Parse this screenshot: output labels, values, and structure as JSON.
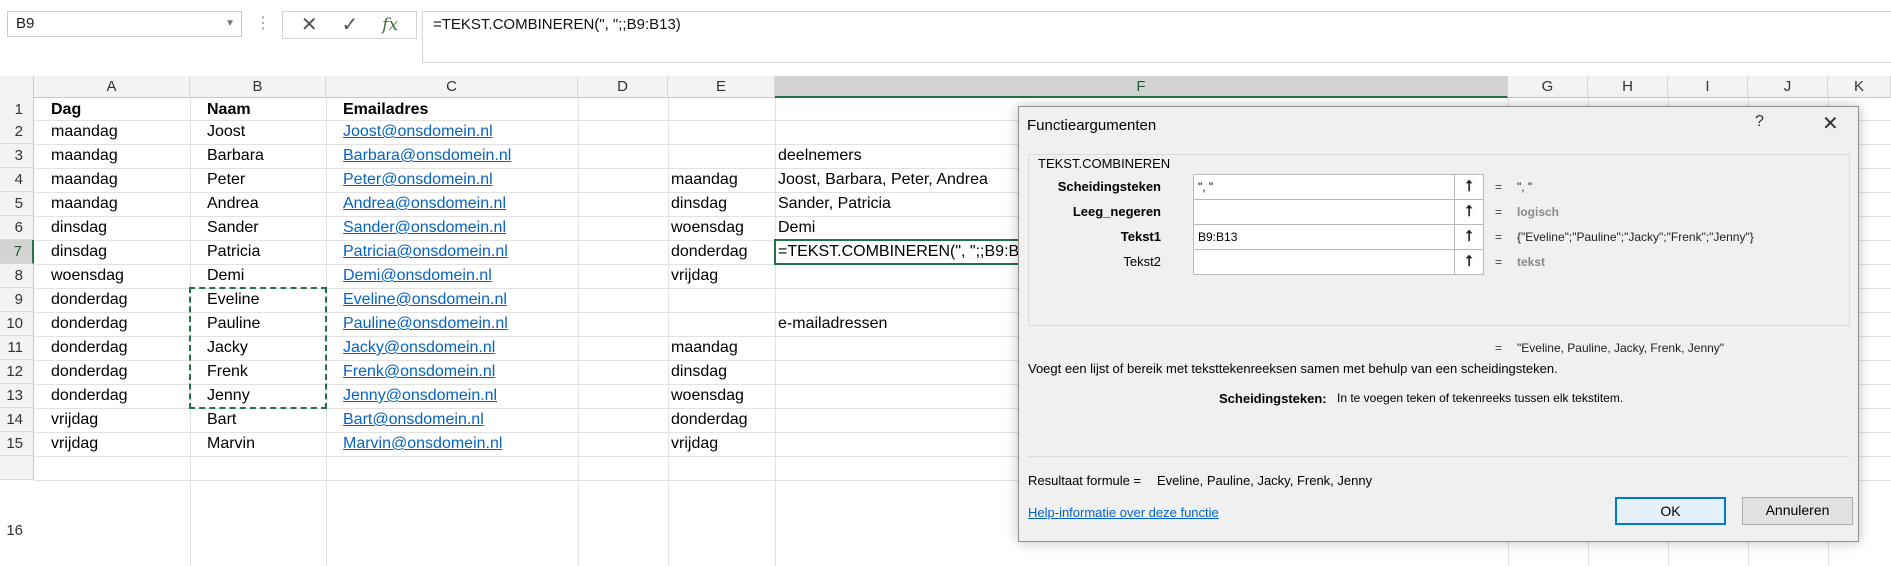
{
  "formula_bar": {
    "name_box": "B9",
    "formula": "=TEKST.COMBINEREN(\", \";;B9:B13)",
    "cancel_glyph": "✕",
    "enter_glyph": "✓",
    "fx_glyph": "fx",
    "dots": "⋮",
    "dropdown_glyph": "▼"
  },
  "sheet": {
    "columns": [
      "A",
      "B",
      "C",
      "D",
      "E",
      "F",
      "G",
      "H",
      "I",
      "J",
      "K"
    ],
    "active_column": "F",
    "active_row": 7,
    "rows": [
      {
        "row": 1,
        "A": "Dag",
        "B": "Naam",
        "C": "Emailadres",
        "E": "",
        "F": ""
      },
      {
        "row": 2,
        "A": "maandag",
        "B": "Joost",
        "C": "Joost@onsdomein.nl",
        "E": "",
        "F": ""
      },
      {
        "row": 3,
        "A": "maandag",
        "B": "Barbara",
        "C": "Barbara@onsdomein.nl",
        "E": "",
        "F": "deelnemers"
      },
      {
        "row": 4,
        "A": "maandag",
        "B": "Peter",
        "C": "Peter@onsdomein.nl",
        "E": "maandag",
        "F": "Joost, Barbara, Peter, Andrea"
      },
      {
        "row": 5,
        "A": "maandag",
        "B": "Andrea",
        "C": "Andrea@onsdomein.nl",
        "E": "dinsdag",
        "F": "Sander, Patricia"
      },
      {
        "row": 6,
        "A": "dinsdag",
        "B": "Sander",
        "C": "Sander@onsdomein.nl",
        "E": "woensdag",
        "F": "Demi"
      },
      {
        "row": 7,
        "A": "dinsdag",
        "B": "Patricia",
        "C": "Patricia@onsdomein.nl",
        "E": "donderdag",
        "F": "=TEKST.COMBINEREN(\", \";;B9:B1"
      },
      {
        "row": 8,
        "A": "woensdag",
        "B": "Demi",
        "C": "Demi@onsdomein.nl",
        "E": "vrijdag",
        "F": ""
      },
      {
        "row": 9,
        "A": "donderdag",
        "B": "Eveline",
        "C": "Eveline@onsdomein.nl",
        "E": "",
        "F": ""
      },
      {
        "row": 10,
        "A": "donderdag",
        "B": "Pauline",
        "C": "Pauline@onsdomein.nl",
        "E": "",
        "F": "e-mailadressen"
      },
      {
        "row": 11,
        "A": "donderdag",
        "B": "Jacky",
        "C": "Jacky@onsdomein.nl",
        "E": "maandag",
        "F": ""
      },
      {
        "row": 12,
        "A": "donderdag",
        "B": "Frenk",
        "C": "Frenk@onsdomein.nl",
        "E": "dinsdag",
        "F": ""
      },
      {
        "row": 13,
        "A": "donderdag",
        "B": "Jenny",
        "C": "Jenny@onsdomein.nl",
        "E": "woensdag",
        "F": ""
      },
      {
        "row": 14,
        "A": "vrijdag",
        "B": "Bart",
        "C": "Bart@onsdomein.nl",
        "E": "donderdag",
        "F": ""
      },
      {
        "row": 15,
        "A": "vrijdag",
        "B": "Marvin",
        "C": "Marvin@onsdomein.nl",
        "E": "vrijdag",
        "F": ""
      },
      {
        "row": 16,
        "A": "",
        "B": "",
        "C": "",
        "E": "",
        "F": ""
      }
    ]
  },
  "dialog": {
    "title": "Functieargumenten",
    "help_glyph": "?",
    "close_glyph": "✕",
    "function_name": "TEKST.COMBINEREN",
    "arguments": [
      {
        "label": "Scheidingsteken",
        "bold": true,
        "value": "\", \"",
        "button_glyph": "⭡",
        "equals": "=",
        "result": "\", \"",
        "result_gray": false
      },
      {
        "label": "Leeg_negeren",
        "bold": true,
        "value": "",
        "button_glyph": "⭡",
        "equals": "=",
        "result": "logisch",
        "result_gray": true
      },
      {
        "label": "Tekst1",
        "bold": true,
        "value": "B9:B13",
        "button_glyph": "⭡",
        "equals": "=",
        "result": "{\"Eveline\";\"Pauline\";\"Jacky\";\"Frenk\";\"Jenny\"}",
        "result_gray": false
      },
      {
        "label": "Tekst2",
        "bold": false,
        "value": "",
        "button_glyph": "⭡",
        "equals": "=",
        "result": "tekst",
        "result_gray": true
      }
    ],
    "result_equals": "=",
    "result_preview": "\"Eveline, Pauline, Jacky, Frenk, Jenny\"",
    "description": "Voegt een lijst of bereik met teksttekenreeksen samen met behulp van een scheidingsteken.",
    "arg_desc_label": "Scheidingsteken:",
    "arg_desc_text": "In te voegen teken of tekenreeks tussen elk tekstitem.",
    "result_label": "Resultaat formule =",
    "result_value": "Eveline, Pauline, Jacky, Frenk, Jenny",
    "help_link": "Help-informatie over deze functie",
    "ok_label": "OK",
    "cancel_label": "Annuleren"
  }
}
